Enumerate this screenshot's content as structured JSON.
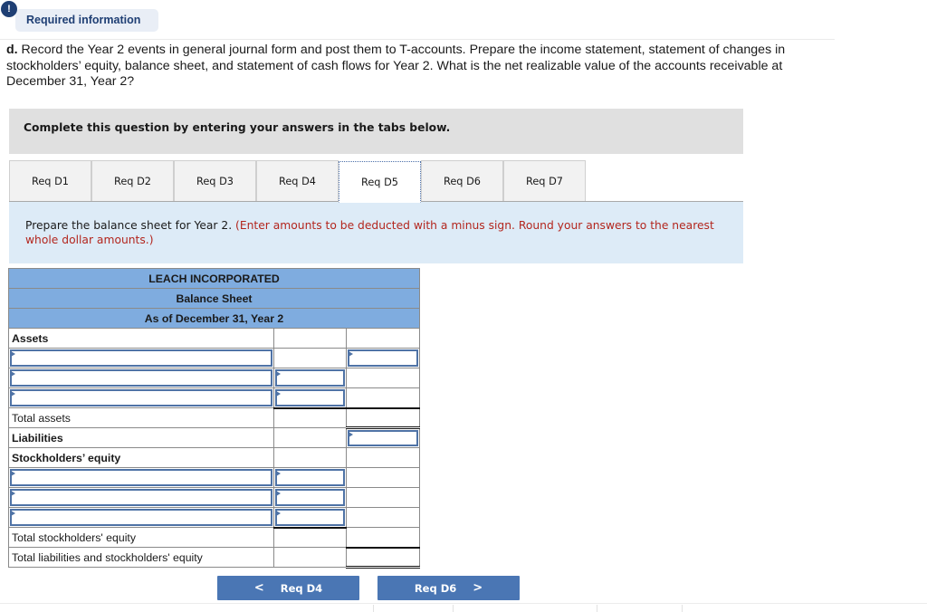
{
  "required_info": {
    "badge_icon": "exclamation-icon",
    "badge_glyph": "!",
    "label": "Required information"
  },
  "question": {
    "part_label": "d.",
    "text": " Record the Year 2 events in general journal form and post them to T-accounts. Prepare the income statement, statement of changes in stockholders’ equity, balance sheet, and statement of cash flows for Year 2. What is the net realizable value of the accounts receivable at December 31, Year 2?"
  },
  "instruction": "Complete this question by entering your answers in the tabs below.",
  "tabs": [
    {
      "label": "Req D1",
      "active": false
    },
    {
      "label": "Req D2",
      "active": false
    },
    {
      "label": "Req D3",
      "active": false
    },
    {
      "label": "Req D4",
      "active": false
    },
    {
      "label": "Req D5",
      "active": true
    },
    {
      "label": "Req D6",
      "active": false
    },
    {
      "label": "Req D7",
      "active": false
    }
  ],
  "prompt": {
    "main": "Prepare the balance sheet for Year 2. ",
    "note": "(Enter amounts to be deducted with a minus sign. Round your answers to the nearest whole dollar amounts.)"
  },
  "balance_sheet": {
    "company": "LEACH INCORPORATED",
    "statement": "Balance Sheet",
    "date": "As of December 31, Year 2",
    "assets_label": "Assets",
    "asset_rows": [
      {
        "label": "",
        "col1": "",
        "col2": ""
      },
      {
        "label": "",
        "col1": "",
        "col2": ""
      },
      {
        "label": "",
        "col1": "",
        "col2": ""
      }
    ],
    "total_assets_label": "Total assets",
    "liabilities_label": "Liabilities",
    "liabilities_value": "",
    "equity_label": "Stockholders’ equity",
    "equity_rows": [
      {
        "label": "",
        "col1": ""
      },
      {
        "label": "",
        "col1": ""
      },
      {
        "label": "",
        "col1": ""
      }
    ],
    "total_equity_label": "Total stockholders' equity",
    "total_liab_equity_label": "Total liabilities and stockholders' equity"
  },
  "navigation": {
    "prev_label": "Req D4",
    "prev_icon": "chevron-left-icon",
    "prev_glyph": "<",
    "next_label": "Req D6",
    "next_icon": "chevron-right-icon",
    "next_glyph": ">"
  }
}
